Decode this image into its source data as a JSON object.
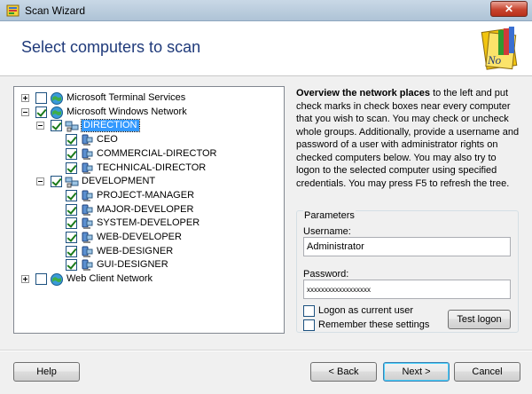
{
  "window": {
    "title": "Scan Wizard",
    "close_label": "✕"
  },
  "header": {
    "title": "Select computers to scan",
    "logo_text": "No"
  },
  "tree": {
    "nodes": [
      {
        "label": "Microsoft Terminal Services",
        "checked": false,
        "expander": "plus"
      },
      {
        "label": "Microsoft Windows Network",
        "checked": true,
        "expander": "minus"
      },
      {
        "label": "DIRECTION",
        "checked": true,
        "expander": "minus",
        "selected": true
      },
      {
        "label": "CEO",
        "checked": true
      },
      {
        "label": "COMMERCIAL-DIRECTOR",
        "checked": true
      },
      {
        "label": "TECHNICAL-DIRECTOR",
        "checked": true
      },
      {
        "label": "DEVELOPMENT",
        "checked": true,
        "expander": "minus"
      },
      {
        "label": "PROJECT-MANAGER",
        "checked": true
      },
      {
        "label": "MAJOR-DEVELOPER",
        "checked": true
      },
      {
        "label": "SYSTEM-DEVELOPER",
        "checked": true
      },
      {
        "label": "WEB-DEVELOPER",
        "checked": true
      },
      {
        "label": "WEB-DESIGNER",
        "checked": true
      },
      {
        "label": "GUI-DESIGNER",
        "checked": true
      },
      {
        "label": "Web Client Network",
        "checked": false,
        "expander": "plus"
      }
    ]
  },
  "description": {
    "bold": "Overview the network places",
    "text": " to the left and put check marks in check boxes near every computer that you wish to scan. You may check or uncheck whole groups. Additionally, provide a username and password of a user with administrator rights on checked computers below. You may also try to logon to the selected computer using specified credentials. You may press F5 to refresh the tree."
  },
  "parameters": {
    "title": "Parameters",
    "username_label": "Username:",
    "username_value": "Administrator",
    "password_label": "Password:",
    "password_value": "xxxxxxxxxxxxxxxxxx",
    "logon_current_label": "Logon as current user",
    "logon_current_checked": false,
    "remember_label": "Remember these settings",
    "remember_checked": false,
    "test_logon_label": "Test logon"
  },
  "footer": {
    "help_label": "Help",
    "back_label": "< Back",
    "next_label": "Next >",
    "cancel_label": "Cancel"
  },
  "colors": {
    "title_accent": "#1f3a7a",
    "selection": "#3399ff",
    "check": "#1a7a1a"
  }
}
